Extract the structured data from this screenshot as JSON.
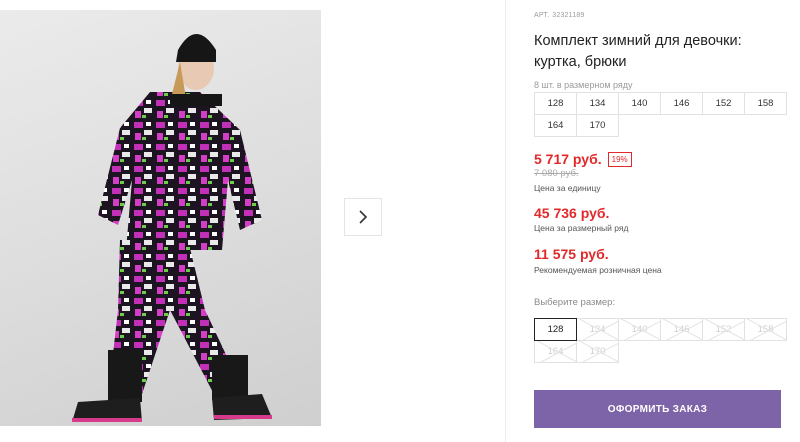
{
  "product": {
    "sku_label": "АРТ.",
    "sku_value": "32321189",
    "title": "Комплект зимний для девочки: куртка, брюки",
    "pack_note": "8 шт. в размерном ряду",
    "pack_sizes": [
      "128",
      "134",
      "140",
      "146",
      "152",
      "158",
      "164",
      "170"
    ]
  },
  "prices": {
    "unit_price": "5 717 руб.",
    "discount": "19%",
    "old_price": "7 080 руб.",
    "unit_label": "Цена за единицу",
    "pack_price": "45 736 руб.",
    "pack_label": "Цена за размерный ряд",
    "retail_price": "11 575 руб.",
    "retail_label": "Рекомендуемая розничная цена"
  },
  "size_select": {
    "label": "Выберите размер:",
    "options": [
      "128",
      "134",
      "140",
      "146",
      "152",
      "158",
      "164",
      "170"
    ],
    "selected": "128"
  },
  "order_button": "ОФОРМИТЬ ЗАКАЗ",
  "gallery": {
    "next_icon": "chevron-right-icon"
  },
  "colors": {
    "accent": "#7d63a7",
    "price": "#e2282a"
  }
}
